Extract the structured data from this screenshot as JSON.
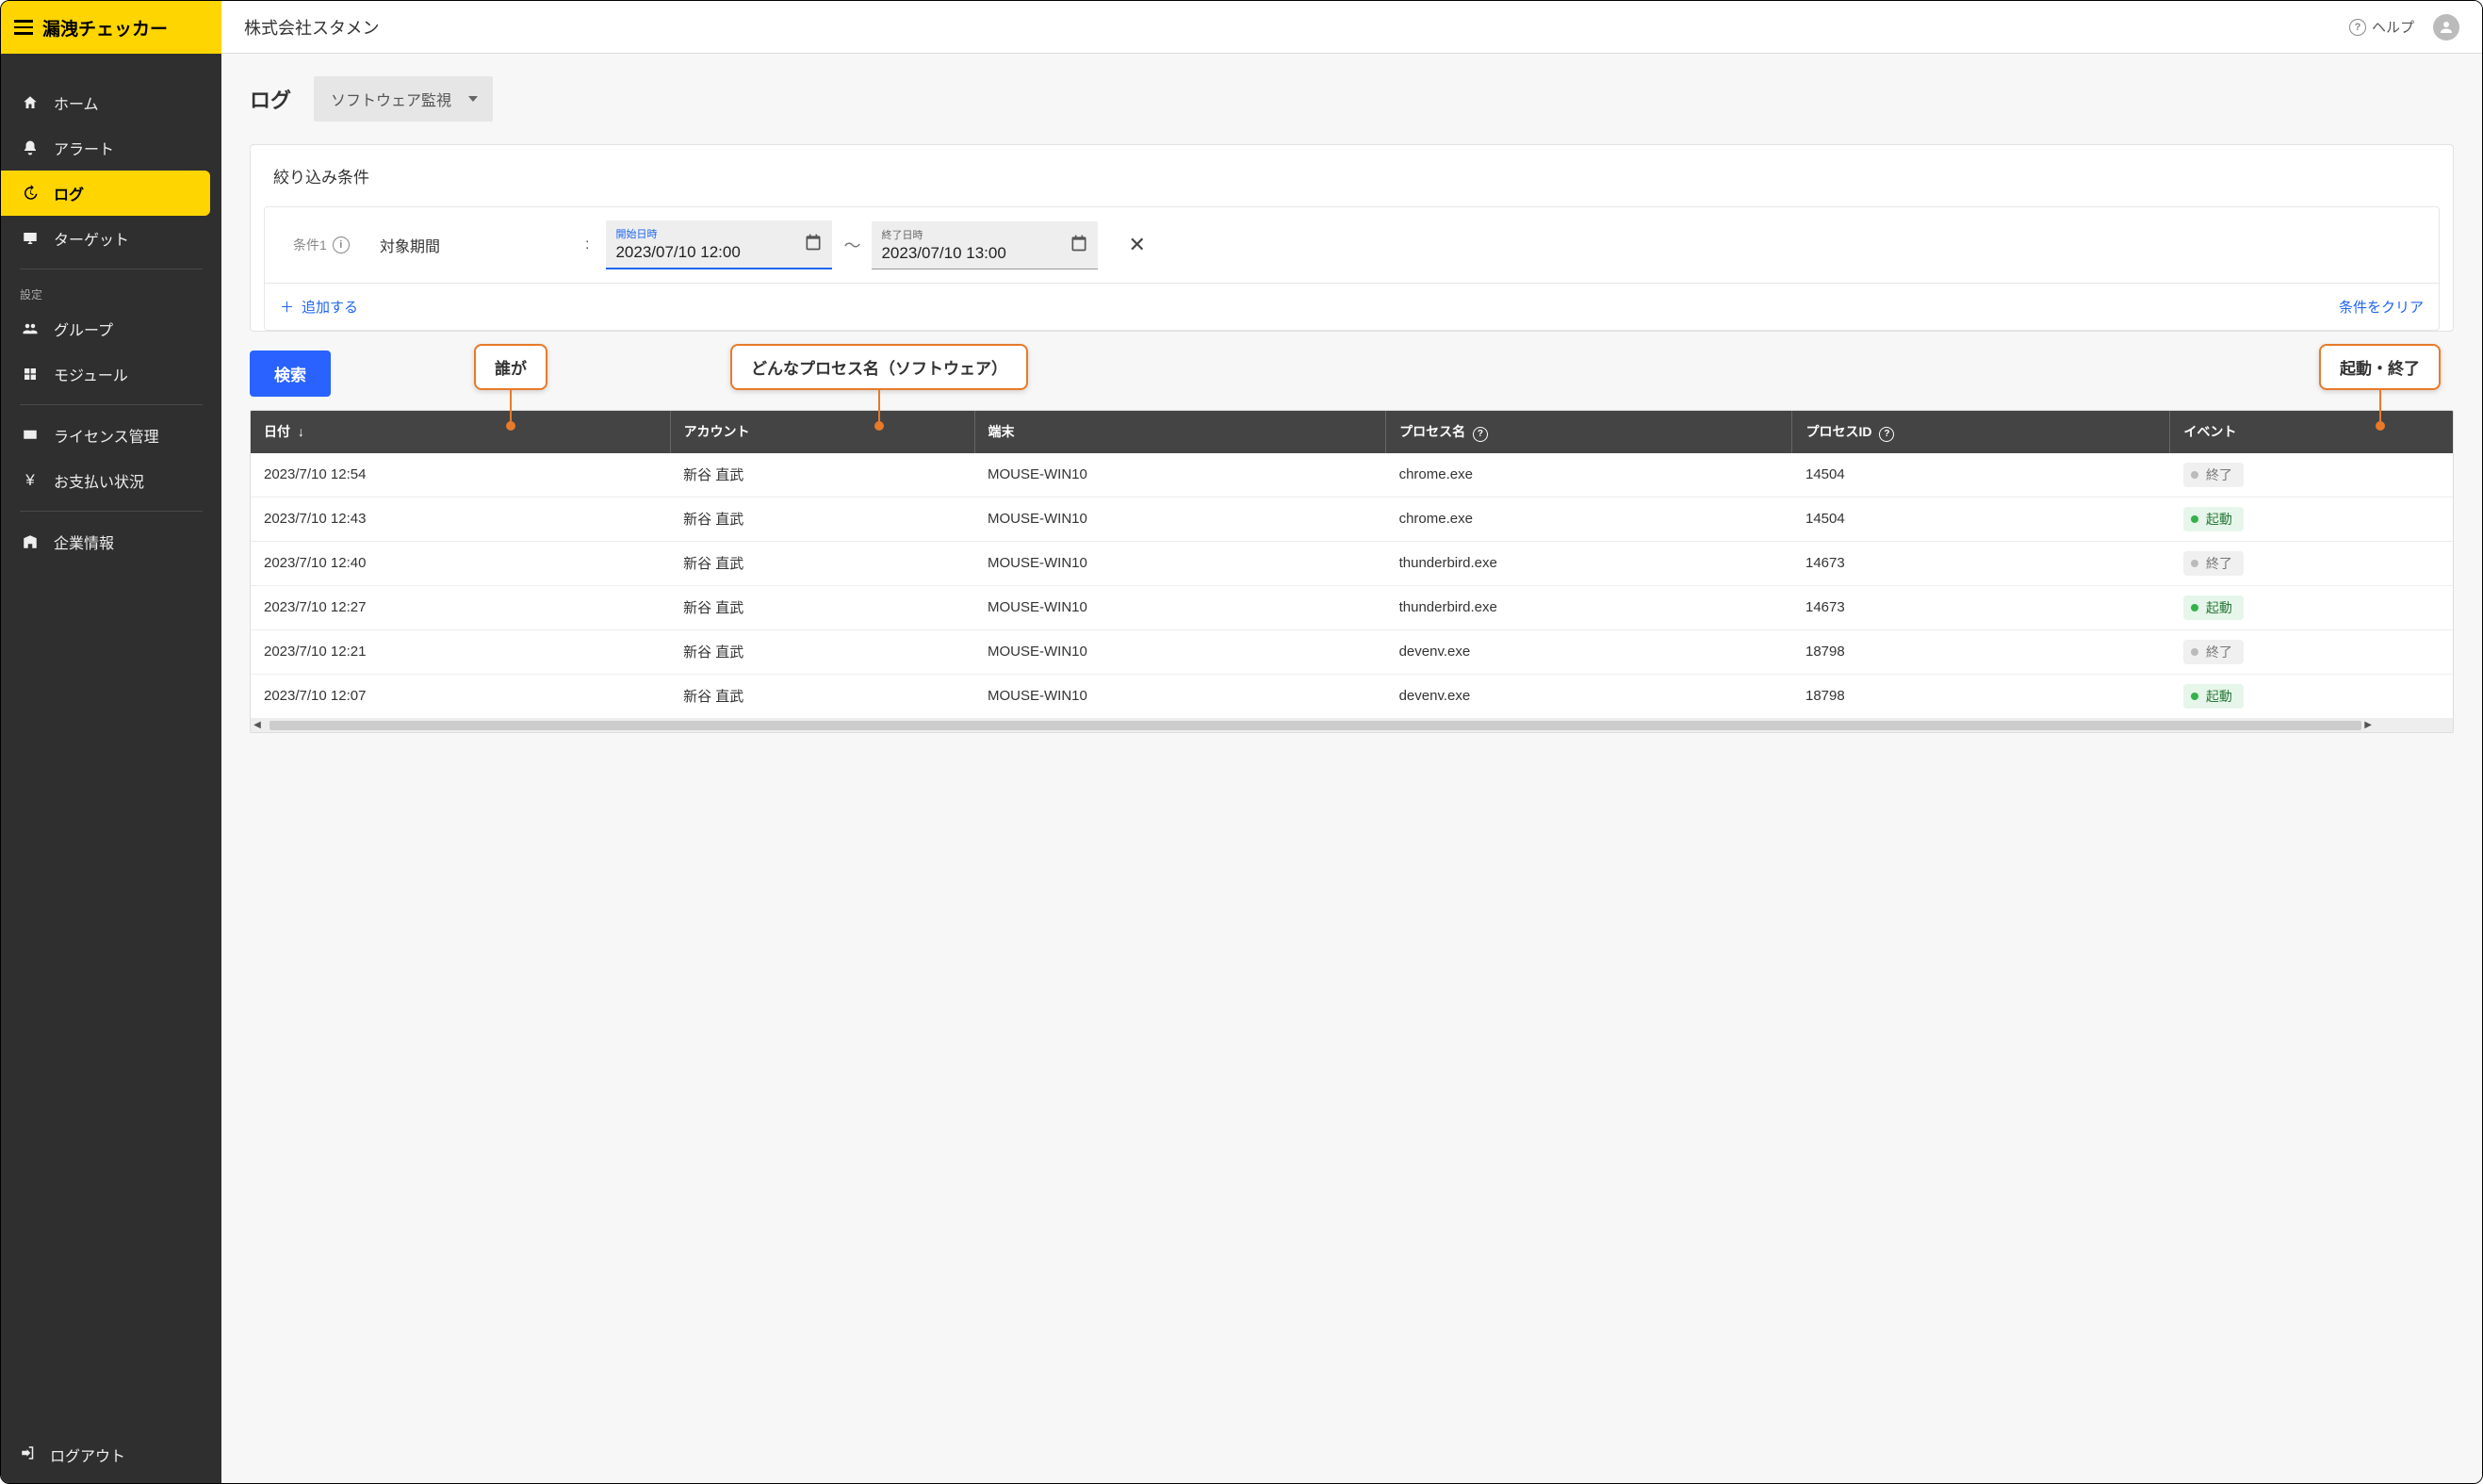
{
  "brand": "漏洩チェッカー",
  "company_name": "株式会社スタメン",
  "help_label": "ヘルプ",
  "sidebar": {
    "items": [
      {
        "label": "ホーム",
        "icon": "home"
      },
      {
        "label": "アラート",
        "icon": "bell"
      },
      {
        "label": "ログ",
        "icon": "history",
        "active": true
      },
      {
        "label": "ターゲット",
        "icon": "monitor"
      }
    ],
    "settings_label": "設定",
    "settings_items": [
      {
        "label": "グループ",
        "icon": "group"
      },
      {
        "label": "モジュール",
        "icon": "grid"
      },
      {
        "label": "ライセンス管理",
        "icon": "license"
      },
      {
        "label": "お支払い状況",
        "icon": "yen"
      },
      {
        "label": "企業情報",
        "icon": "company"
      }
    ],
    "logout_label": "ログアウト"
  },
  "page": {
    "title": "ログ",
    "select_value": "ソフトウェア監視"
  },
  "filter": {
    "panel_title": "絞り込み条件",
    "cond_label": "条件1",
    "field_name": "対象期間",
    "start_label": "開始日時",
    "start_value": "2023/07/10 12:00",
    "end_label": "終了日時",
    "end_value": "2023/07/10 13:00",
    "add_label": "追加する",
    "clear_label": "条件をクリア",
    "search_label": "検索"
  },
  "callouts": {
    "who": "誰が",
    "process": "どんなプロセス名（ソフトウェア）",
    "event": "起動・終了"
  },
  "table": {
    "columns": {
      "date": "日付",
      "account": "アカウント",
      "terminal": "端末",
      "process": "プロセス名",
      "pid": "プロセスID",
      "event": "イベント"
    },
    "event_labels": {
      "start": "起動",
      "end": "終了"
    },
    "rows": [
      {
        "date": "2023/7/10 12:54",
        "account": "新谷 直武",
        "terminal": "MOUSE-WIN10",
        "process": "chrome.exe",
        "pid": "14504",
        "event": "end"
      },
      {
        "date": "2023/7/10 12:43",
        "account": "新谷 直武",
        "terminal": "MOUSE-WIN10",
        "process": "chrome.exe",
        "pid": "14504",
        "event": "start"
      },
      {
        "date": "2023/7/10 12:40",
        "account": "新谷 直武",
        "terminal": "MOUSE-WIN10",
        "process": "thunderbird.exe",
        "pid": "14673",
        "event": "end"
      },
      {
        "date": "2023/7/10 12:27",
        "account": "新谷 直武",
        "terminal": "MOUSE-WIN10",
        "process": "thunderbird.exe",
        "pid": "14673",
        "event": "start"
      },
      {
        "date": "2023/7/10 12:21",
        "account": "新谷 直武",
        "terminal": "MOUSE-WIN10",
        "process": "devenv.exe",
        "pid": "18798",
        "event": "end"
      },
      {
        "date": "2023/7/10 12:07",
        "account": "新谷 直武",
        "terminal": "MOUSE-WIN10",
        "process": "devenv.exe",
        "pid": "18798",
        "event": "start"
      }
    ]
  }
}
